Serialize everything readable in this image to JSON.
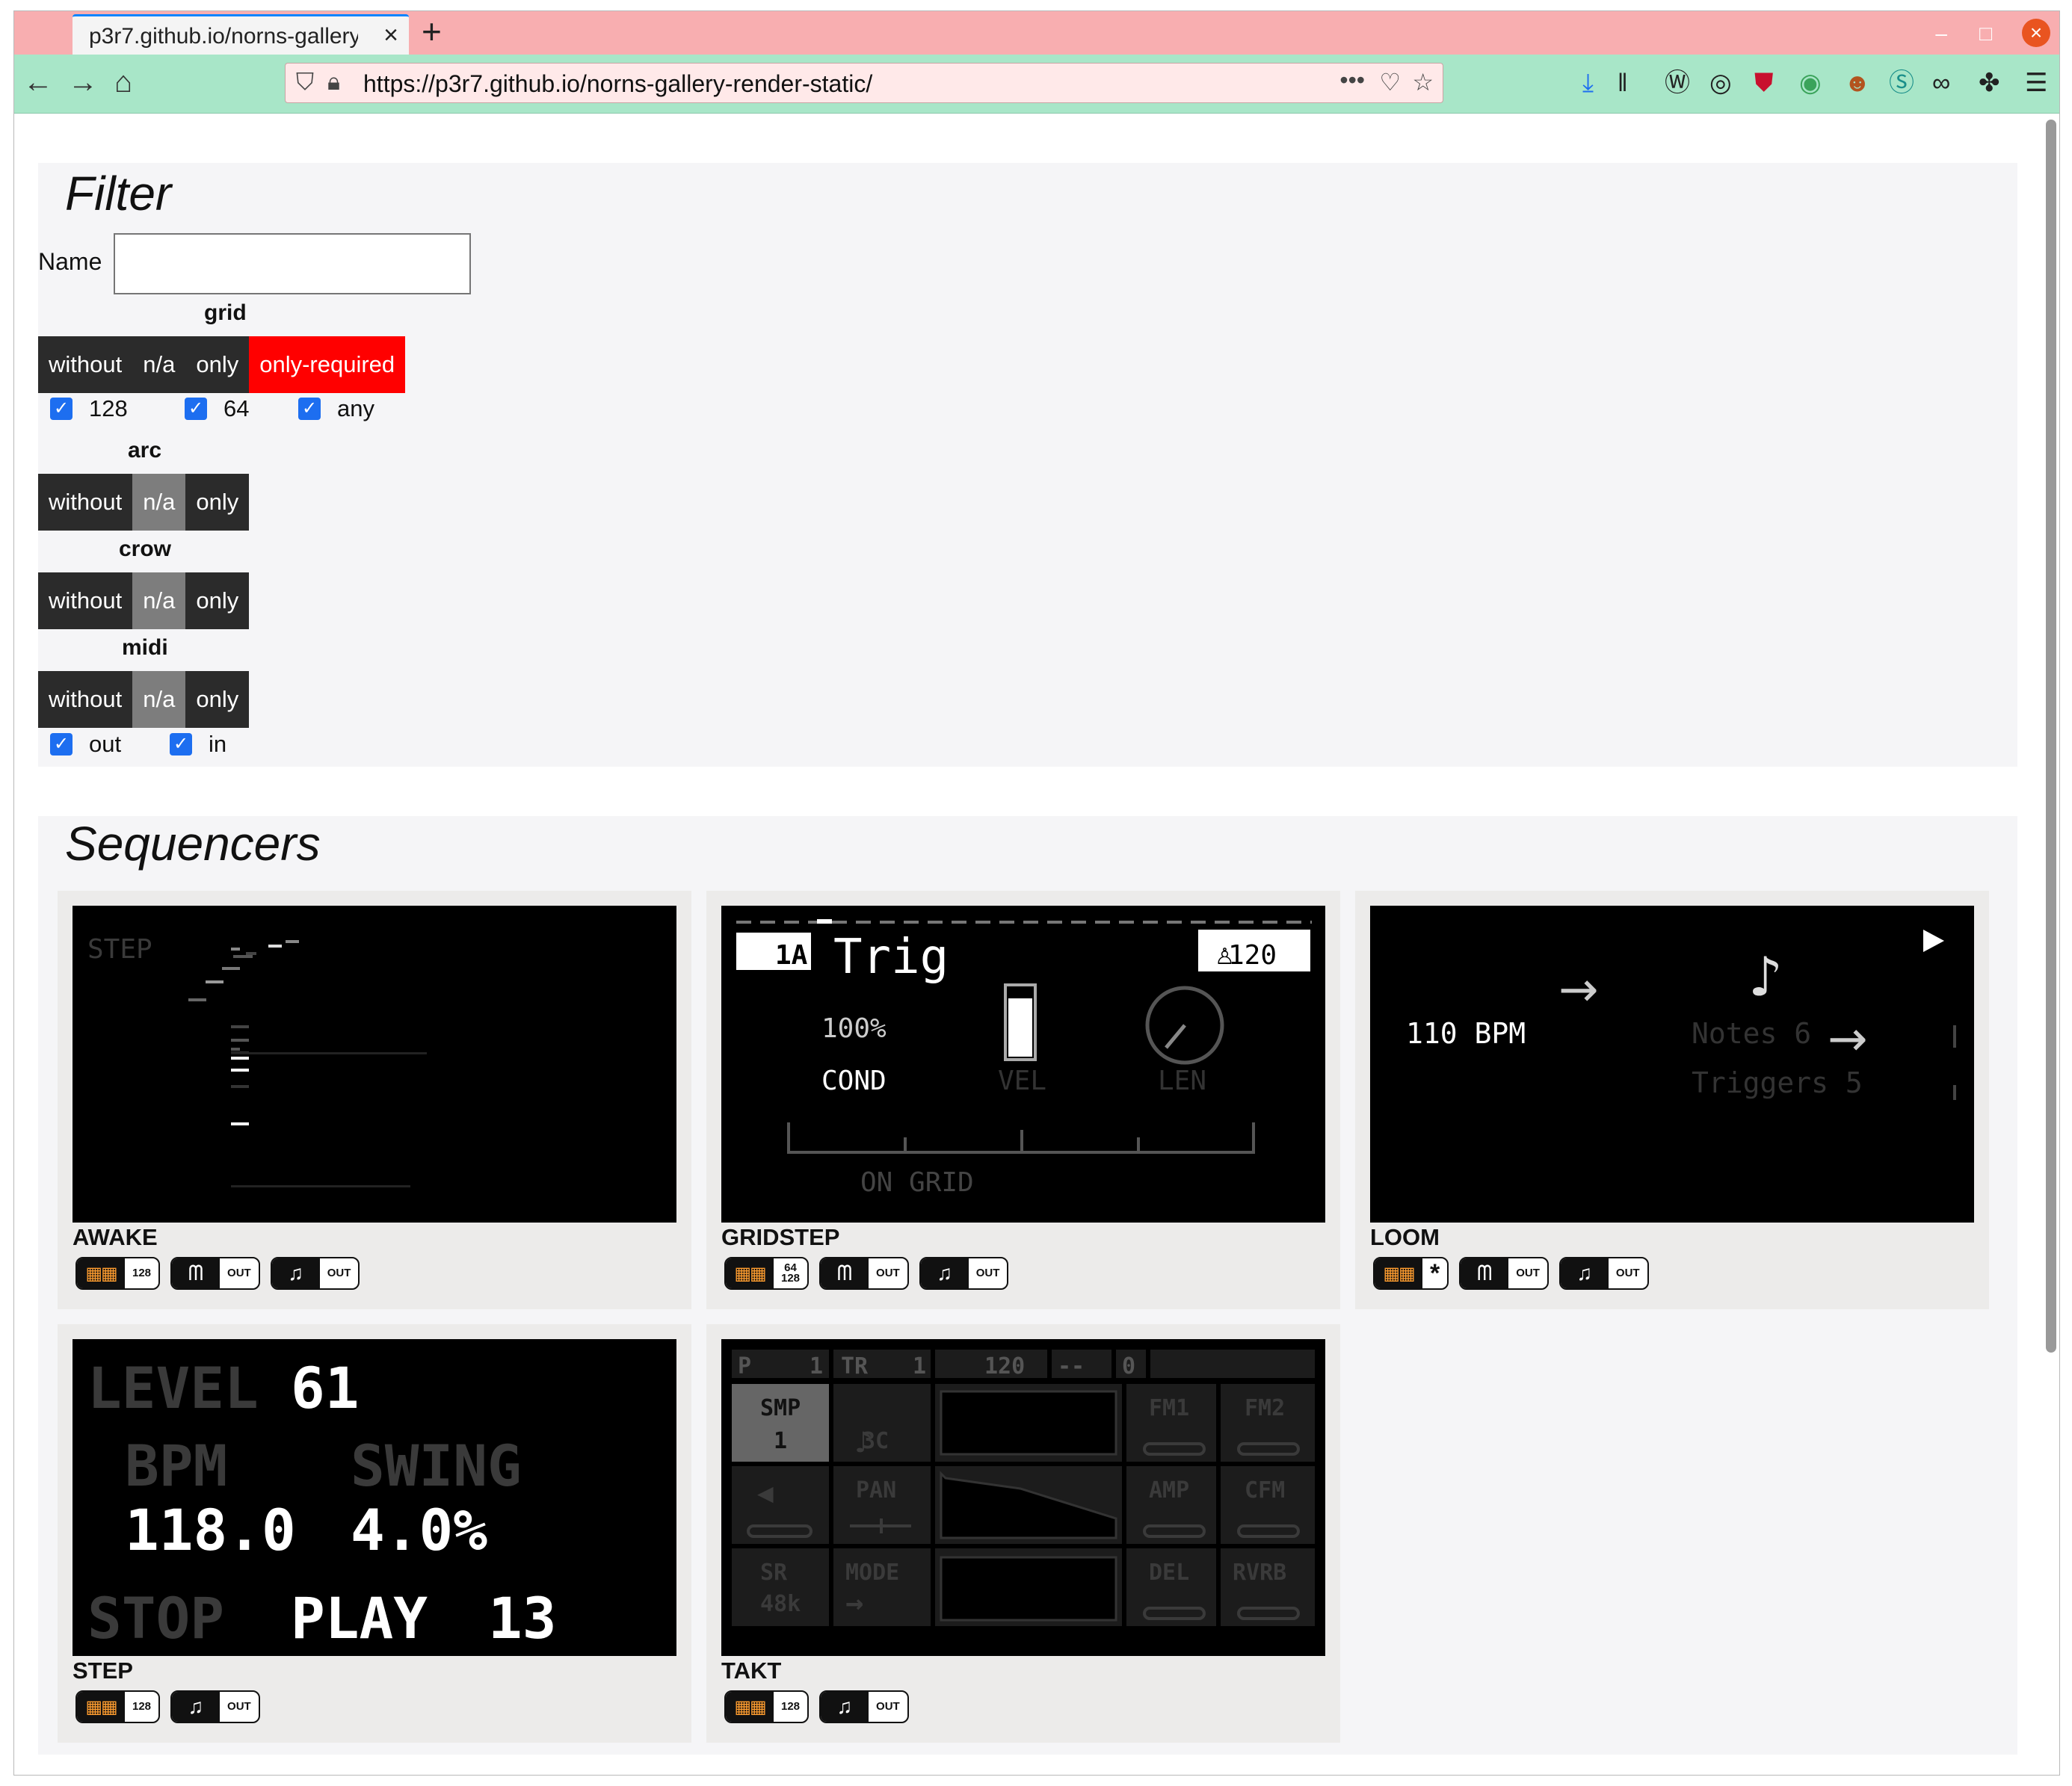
{
  "browser": {
    "tab_title": "p3r7.github.io/norns-gallery",
    "tab_close": "×",
    "new_tab": "+",
    "url": "https://p3r7.github.io/norns-gallery-render-static/",
    "page_actions": "•••",
    "window_min": "–",
    "window_max": "□",
    "window_close": "×"
  },
  "filter": {
    "heading": "Filter",
    "name_label": "Name",
    "name_value": "",
    "groups": [
      {
        "label": "grid",
        "options": [
          "without",
          "n/a",
          "only",
          "only-required"
        ],
        "selected": "only-required"
      },
      {
        "label": "arc",
        "options": [
          "without",
          "n/a",
          "only"
        ],
        "selected": "n/a"
      },
      {
        "label": "crow",
        "options": [
          "without",
          "n/a",
          "only"
        ],
        "selected": "n/a"
      },
      {
        "label": "midi",
        "options": [
          "without",
          "n/a",
          "only"
        ],
        "selected": "n/a"
      }
    ],
    "grid_sizes": [
      "128",
      "64",
      "any"
    ],
    "midi_dirs": [
      "out",
      "in"
    ]
  },
  "sequencers": {
    "heading": "Sequencers",
    "cards": [
      {
        "title": "AWAKE",
        "badges": [
          {
            "icon": "grid-icon",
            "text": "128"
          },
          {
            "icon": "crow-icon",
            "text": "OUT"
          },
          {
            "icon": "midi-note-icon",
            "text": "OUT"
          }
        ],
        "screen": {
          "label": "STEP"
        }
      },
      {
        "title": "GRIDSTEP",
        "badges": [
          {
            "icon": "grid-icon",
            "text": "64",
            "text2": "128"
          },
          {
            "icon": "crow-icon",
            "text": "OUT"
          },
          {
            "icon": "midi-note-icon",
            "text": "OUT"
          }
        ],
        "screen": {
          "pattern": "1A",
          "mode": "Trig",
          "tempo": "120",
          "percent": "100%",
          "cond": "COND",
          "vel": "VEL",
          "len": "LEN",
          "footer": "ON GRID"
        }
      },
      {
        "title": "LOOM",
        "badges": [
          {
            "icon": "grid-icon",
            "text": "*"
          },
          {
            "icon": "crow-icon",
            "text": "OUT"
          },
          {
            "icon": "midi-note-icon",
            "text": "OUT"
          }
        ],
        "screen": {
          "bpm": "110 BPM",
          "notes": "Notes 6",
          "triggers": "Triggers 5"
        }
      },
      {
        "title": "STEP",
        "badges": [
          {
            "icon": "grid-icon",
            "text": "128"
          },
          {
            "icon": "midi-note-icon",
            "text": "OUT"
          }
        ],
        "screen": {
          "level_label": "LEVEL",
          "level": "61",
          "bpm_label": "BPM",
          "bpm": "118.0",
          "swing_label": "SWING",
          "swing": "4.0%",
          "stop": "STOP",
          "play": "PLAY",
          "step": "13"
        }
      },
      {
        "title": "TAKT",
        "badges": [
          {
            "icon": "grid-icon",
            "text": "128"
          },
          {
            "icon": "midi-note-icon",
            "text": "OUT"
          }
        ],
        "screen": {
          "top": [
            "P",
            "1",
            "TR",
            "1",
            "120",
            "--",
            "0"
          ],
          "cells": [
            "SMP",
            "1",
            "3C",
            "FM1",
            "FM2",
            "PAN",
            "AMP",
            "CFM",
            "SR",
            "48k",
            "MODE",
            "DEL",
            "RVRB"
          ]
        }
      }
    ]
  }
}
